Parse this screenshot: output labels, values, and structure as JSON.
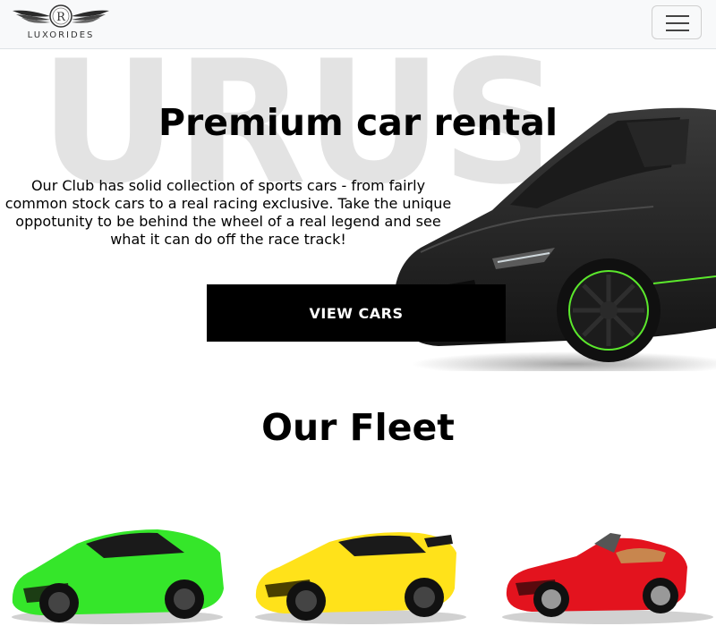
{
  "header": {
    "brand_text": "LUXORIDES",
    "logo_letter": "R",
    "menu_icon": "hamburger-menu-icon"
  },
  "hero": {
    "background_word": "URUS",
    "title": "Premium car rental",
    "description": "Our Club has solid collection of sports cars - from fairly common stock cars to a real racing exclusive. Take the unique oppotunity to be behind the wheel of a real legend and see what it can do off the race track!",
    "cta_label": "VIEW CARS"
  },
  "fleet": {
    "title": "Our Fleet",
    "cars": [
      {
        "color": "#35e62a"
      },
      {
        "color": "#ffe21a"
      },
      {
        "color": "#e3131e"
      }
    ]
  },
  "colors": {
    "navbar_bg": "#f8f9fa",
    "cta_bg": "#000000",
    "cta_text": "#ffffff",
    "bg_word": "#e3e3e3"
  }
}
